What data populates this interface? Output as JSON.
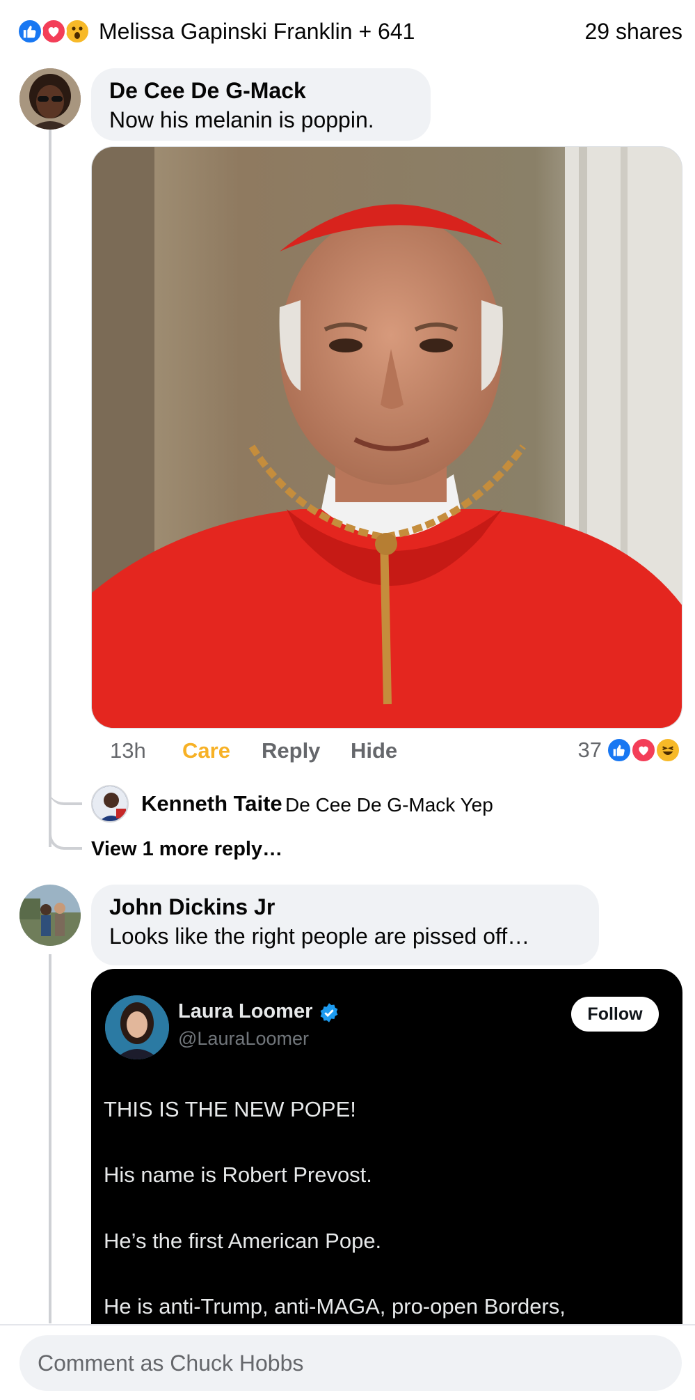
{
  "top_bar": {
    "reactors_text": "Melissa Gapinski Franklin + 641",
    "shares_text": "29 shares",
    "reaction_icons": [
      "like-icon",
      "love-icon",
      "wow-icon"
    ]
  },
  "comments": [
    {
      "author": "De Cee De G-Mack",
      "text": "Now his melanin is poppin.",
      "attachment": "photo",
      "actions": {
        "time": "13h",
        "reaction_label": "Care",
        "reply_label": "Reply",
        "hide_label": "Hide"
      },
      "reaction_count": "37",
      "reaction_icons": [
        "like-icon",
        "love-icon",
        "haha-icon"
      ],
      "reply": {
        "author": "Kenneth Taite",
        "text": "De Cee De G-Mack Yep"
      },
      "view_more_text": "View 1 more reply…"
    },
    {
      "author": "John Dickins Jr",
      "text": "Looks like the right people are pissed off…",
      "attachment": "tweet",
      "tweet": {
        "name": "Laura Loomer",
        "handle": "@LauraLoomer",
        "follow_label": "Follow",
        "lines": [
          "THIS IS THE NEW POPE!",
          "His name is Robert Prevost.",
          "He’s the first American Pope.",
          "He is anti-Trump, anti-MAGA, pro-open Borders,"
        ]
      }
    }
  ],
  "composer": {
    "placeholder": "Comment as Chuck Hobbs"
  },
  "colors": {
    "like_blue": "#1877f2",
    "love_red": "#f33e58",
    "care_yellow": "#f7b125",
    "bubble_bg": "#f0f2f5",
    "secondary_text": "#65676b"
  }
}
